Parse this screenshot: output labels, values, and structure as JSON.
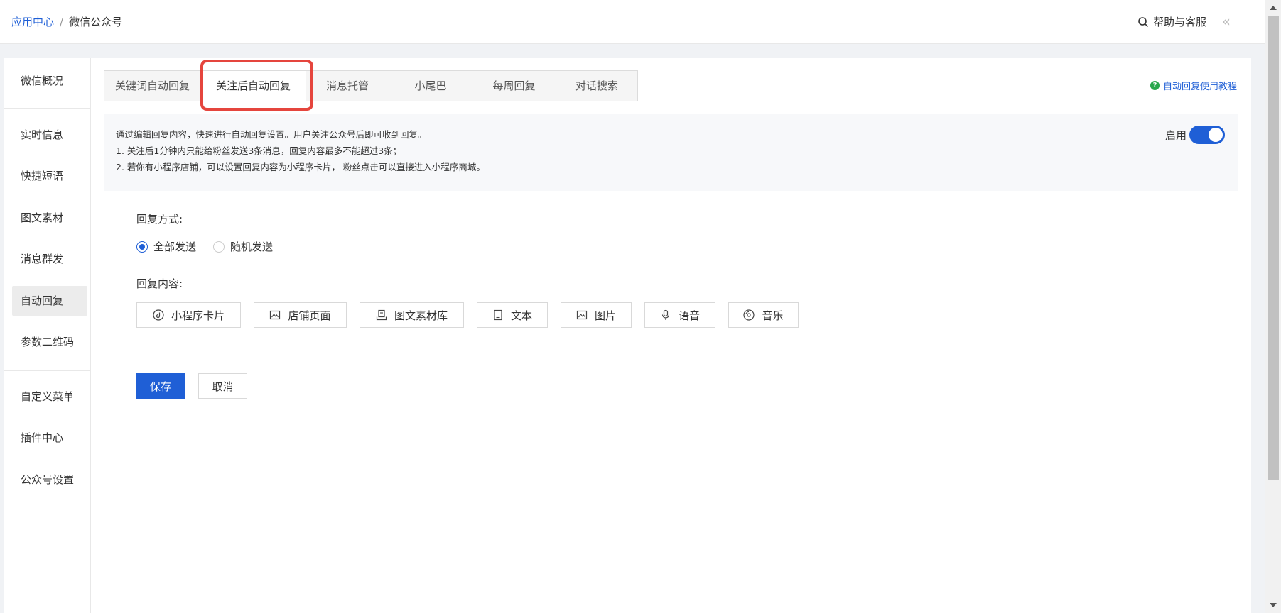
{
  "breadcrumb": {
    "root": "应用中心",
    "separator": "/",
    "current": "微信公众号"
  },
  "header": {
    "help_label": "帮助与客服",
    "collapse_symbol": "«"
  },
  "sidebar": {
    "items": [
      {
        "label": "微信概况"
      },
      {
        "label": "实时信息"
      },
      {
        "label": "快捷短语"
      },
      {
        "label": "图文素材"
      },
      {
        "label": "消息群发"
      },
      {
        "label": "自动回复"
      },
      {
        "label": "参数二维码"
      },
      {
        "label": "自定义菜单"
      },
      {
        "label": "插件中心"
      },
      {
        "label": "公众号设置"
      }
    ],
    "active": "自动回复"
  },
  "tabs": [
    {
      "label": "关键词自动回复"
    },
    {
      "label": "关注后自动回复"
    },
    {
      "label": "消息托管"
    },
    {
      "label": "小尾巴"
    },
    {
      "label": "每周回复"
    },
    {
      "label": "对话搜索"
    }
  ],
  "active_tab": "关注后自动回复",
  "tutorial_link": "自动回复使用教程",
  "notice": {
    "line1": "通过编辑回复内容，快速进行自动回复设置。用户关注公众号后即可收到回复。",
    "line2": "1. 关注后1分钟内只能给粉丝发送3条消息，回复内容最多不能超过3条；",
    "line3": "2. 若你有小程序店铺，可以设置回复内容为小程序卡片， 粉丝点击可以直接进入小程序商城。"
  },
  "toggle": {
    "label": "启用",
    "enabled": true
  },
  "reply_mode": {
    "label": "回复方式:",
    "options": [
      {
        "label": "全部发送",
        "checked": true
      },
      {
        "label": "随机发送",
        "checked": false
      }
    ]
  },
  "reply_content": {
    "label": "回复内容:",
    "buttons": [
      {
        "label": "小程序卡片",
        "icon": "mini-program-icon"
      },
      {
        "label": "店铺页面",
        "icon": "store-page-icon"
      },
      {
        "label": "图文素材库",
        "icon": "article-library-icon"
      },
      {
        "label": "文本",
        "icon": "text-icon"
      },
      {
        "label": "图片",
        "icon": "image-icon"
      },
      {
        "label": "语音",
        "icon": "microphone-icon"
      },
      {
        "label": "音乐",
        "icon": "music-icon"
      }
    ]
  },
  "actions": {
    "save": "保存",
    "cancel": "取消"
  },
  "colors": {
    "accent": "#1f5fd6",
    "highlight": "#e5453d",
    "help_icon": "#2aa74d"
  }
}
